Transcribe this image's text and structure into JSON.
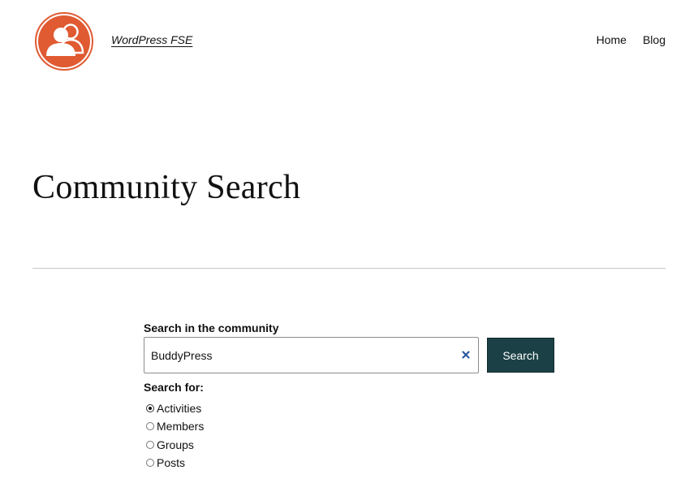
{
  "header": {
    "site_title": "WordPress FSE",
    "logo_icon": "community-users-icon",
    "logo_color": "#e05a32",
    "nav": [
      {
        "label": "Home"
      },
      {
        "label": "Blog"
      }
    ]
  },
  "main": {
    "page_title": "Community Search",
    "search": {
      "label": "Search in the community",
      "value": "BuddyPress",
      "clear_icon": "close-icon",
      "button_label": "Search",
      "button_color": "#1b4146"
    },
    "search_for": {
      "label": "Search for:",
      "selected": "Activities",
      "options": [
        {
          "label": "Activities"
        },
        {
          "label": "Members"
        },
        {
          "label": "Groups"
        },
        {
          "label": "Posts"
        }
      ]
    }
  }
}
